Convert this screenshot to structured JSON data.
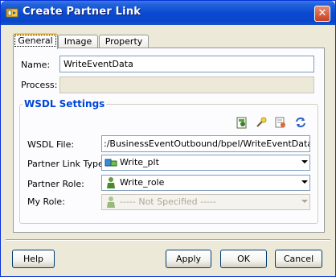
{
  "window": {
    "title": "Create Partner Link"
  },
  "tabs": [
    {
      "label": "General"
    },
    {
      "label": "Image"
    },
    {
      "label": "Property"
    }
  ],
  "form": {
    "name_label": "Name:",
    "name_value": "WriteEventData",
    "process_label": "Process:",
    "process_value": ""
  },
  "wsdl": {
    "section_title": "WSDL Settings",
    "toolbar_icons": [
      "service-explorer-icon",
      "wizard-icon",
      "define-adapter-icon",
      "refresh-icon"
    ],
    "file_label": "WSDL File:",
    "file_value": ":/BusinessEventOutbound/bpel/WriteEventData.wsdl",
    "link_type_label": "Partner Link Type:",
    "link_type_value": "Write_plt",
    "partner_role_label": "Partner Role:",
    "partner_role_value": "Write_role",
    "my_role_label": "My Role:",
    "my_role_value": "----- Not Specified -----"
  },
  "buttons": {
    "help": "Help",
    "apply": "Apply",
    "ok": "OK",
    "cancel": "Cancel"
  }
}
